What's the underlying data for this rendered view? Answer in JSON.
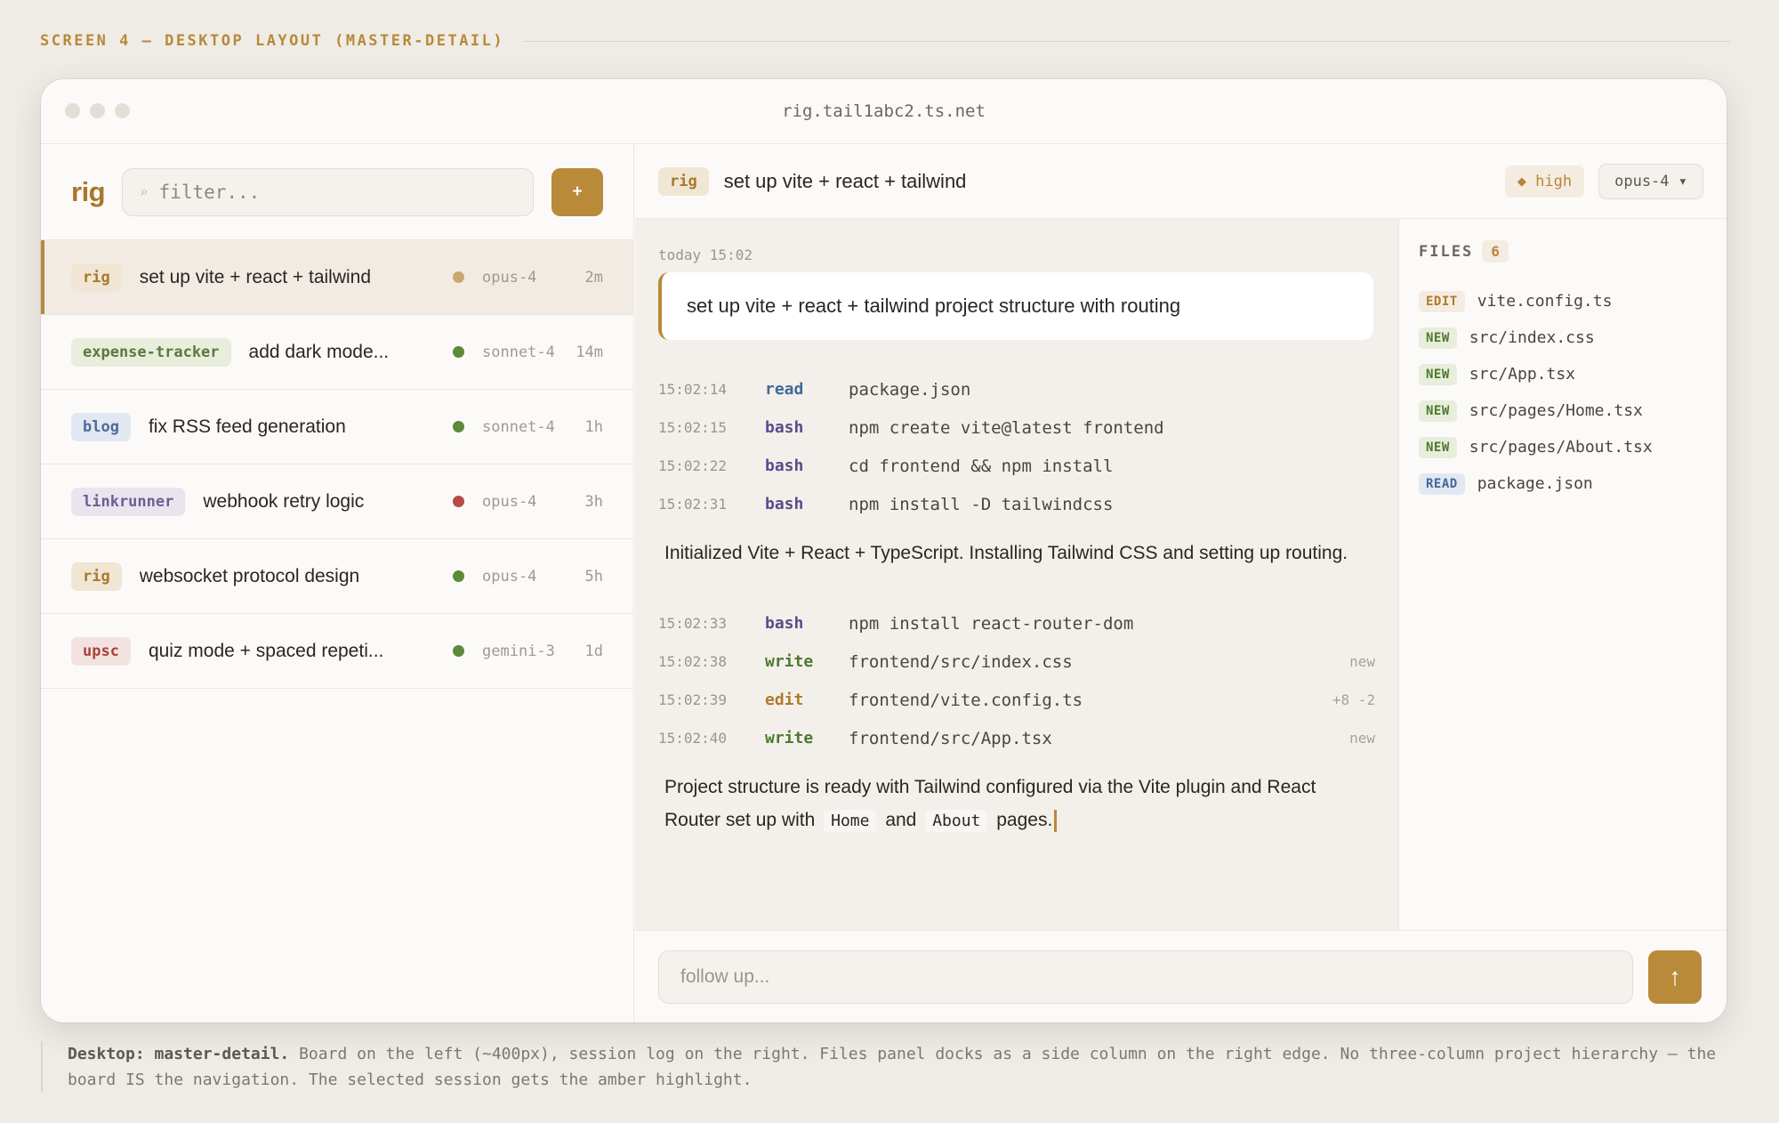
{
  "screen_label": "SCREEN 4 — DESKTOP LAYOUT (MASTER-DETAIL)",
  "window": {
    "url": "rig.tail1abc2.ts.net"
  },
  "sidebar": {
    "brand": "rig",
    "filter_placeholder": "filter...",
    "filter_icon": "⌕",
    "add_label": "+",
    "sessions": [
      {
        "tag": "rig",
        "title": "set up vite + react + tailwind",
        "status_color": "#c9a870",
        "model": "opus-4",
        "age": "2m",
        "selected": true
      },
      {
        "tag": "expense-tracker",
        "title": "add dark mode...",
        "status_color": "#5a8a3a",
        "model": "sonnet-4",
        "age": "14m"
      },
      {
        "tag": "blog",
        "title": "fix RSS feed generation",
        "status_color": "#5a8a3a",
        "model": "sonnet-4",
        "age": "1h"
      },
      {
        "tag": "linkrunner",
        "title": "webhook retry logic",
        "status_color": "#b84a44",
        "model": "opus-4",
        "age": "3h"
      },
      {
        "tag": "rig",
        "title": "websocket protocol design",
        "status_color": "#5a8a3a",
        "model": "opus-4",
        "age": "5h"
      },
      {
        "tag": "upsc",
        "title": "quiz mode + spaced repeti...",
        "status_color": "#5a8a3a",
        "model": "gemini-3",
        "age": "1d"
      }
    ]
  },
  "main": {
    "tag": "rig",
    "title": "set up vite + react + tailwind",
    "priority": "◆ high",
    "model_select": "opus-4 ▾",
    "timestamp": "today 15:02",
    "prompt": "set up vite + react + tailwind project structure with routing",
    "tools_1": [
      {
        "time": "15:02:14",
        "verb": "read",
        "arg": "package.json",
        "note": ""
      },
      {
        "time": "15:02:15",
        "verb": "bash",
        "arg": "npm create vite@latest frontend",
        "note": ""
      },
      {
        "time": "15:02:22",
        "verb": "bash",
        "arg": "cd frontend && npm install",
        "note": ""
      },
      {
        "time": "15:02:31",
        "verb": "bash",
        "arg": "npm install -D tailwindcss",
        "note": ""
      }
    ],
    "message_1": "Initialized Vite + React + TypeScript. Installing Tailwind CSS and setting up routing.",
    "tools_2": [
      {
        "time": "15:02:33",
        "verb": "bash",
        "arg": "npm install react-router-dom",
        "note": ""
      },
      {
        "time": "15:02:38",
        "verb": "write",
        "arg": "frontend/src/index.css",
        "note": "new"
      },
      {
        "time": "15:02:39",
        "verb": "edit",
        "arg": "frontend/vite.config.ts",
        "note": "+8 -2"
      },
      {
        "time": "15:02:40",
        "verb": "write",
        "arg": "frontend/src/App.tsx",
        "note": "new"
      }
    ],
    "message_2": {
      "before": "Project structure is ready with Tailwind configured via the Vite plugin and React Router set up with",
      "code_1": "Home",
      "mid": "and",
      "code_2": "About",
      "after": "pages."
    }
  },
  "files": {
    "label": "FILES",
    "count": "6",
    "items": [
      {
        "badge": "EDIT",
        "name": "vite.config.ts"
      },
      {
        "badge": "NEW",
        "name": "src/index.css"
      },
      {
        "badge": "NEW",
        "name": "src/App.tsx"
      },
      {
        "badge": "NEW",
        "name": "src/pages/Home.tsx"
      },
      {
        "badge": "NEW",
        "name": "src/pages/About.tsx"
      },
      {
        "badge": "READ",
        "name": "package.json"
      }
    ]
  },
  "composer": {
    "placeholder": "follow up...",
    "send_icon": "↑"
  },
  "caption": {
    "bold": "Desktop: master-detail.",
    "text": "Board on the left (~400px), session log on the right. Files panel docks as a side column on the right edge. No three-column project hierarchy — the board IS the navigation. The selected session gets the amber highlight."
  }
}
